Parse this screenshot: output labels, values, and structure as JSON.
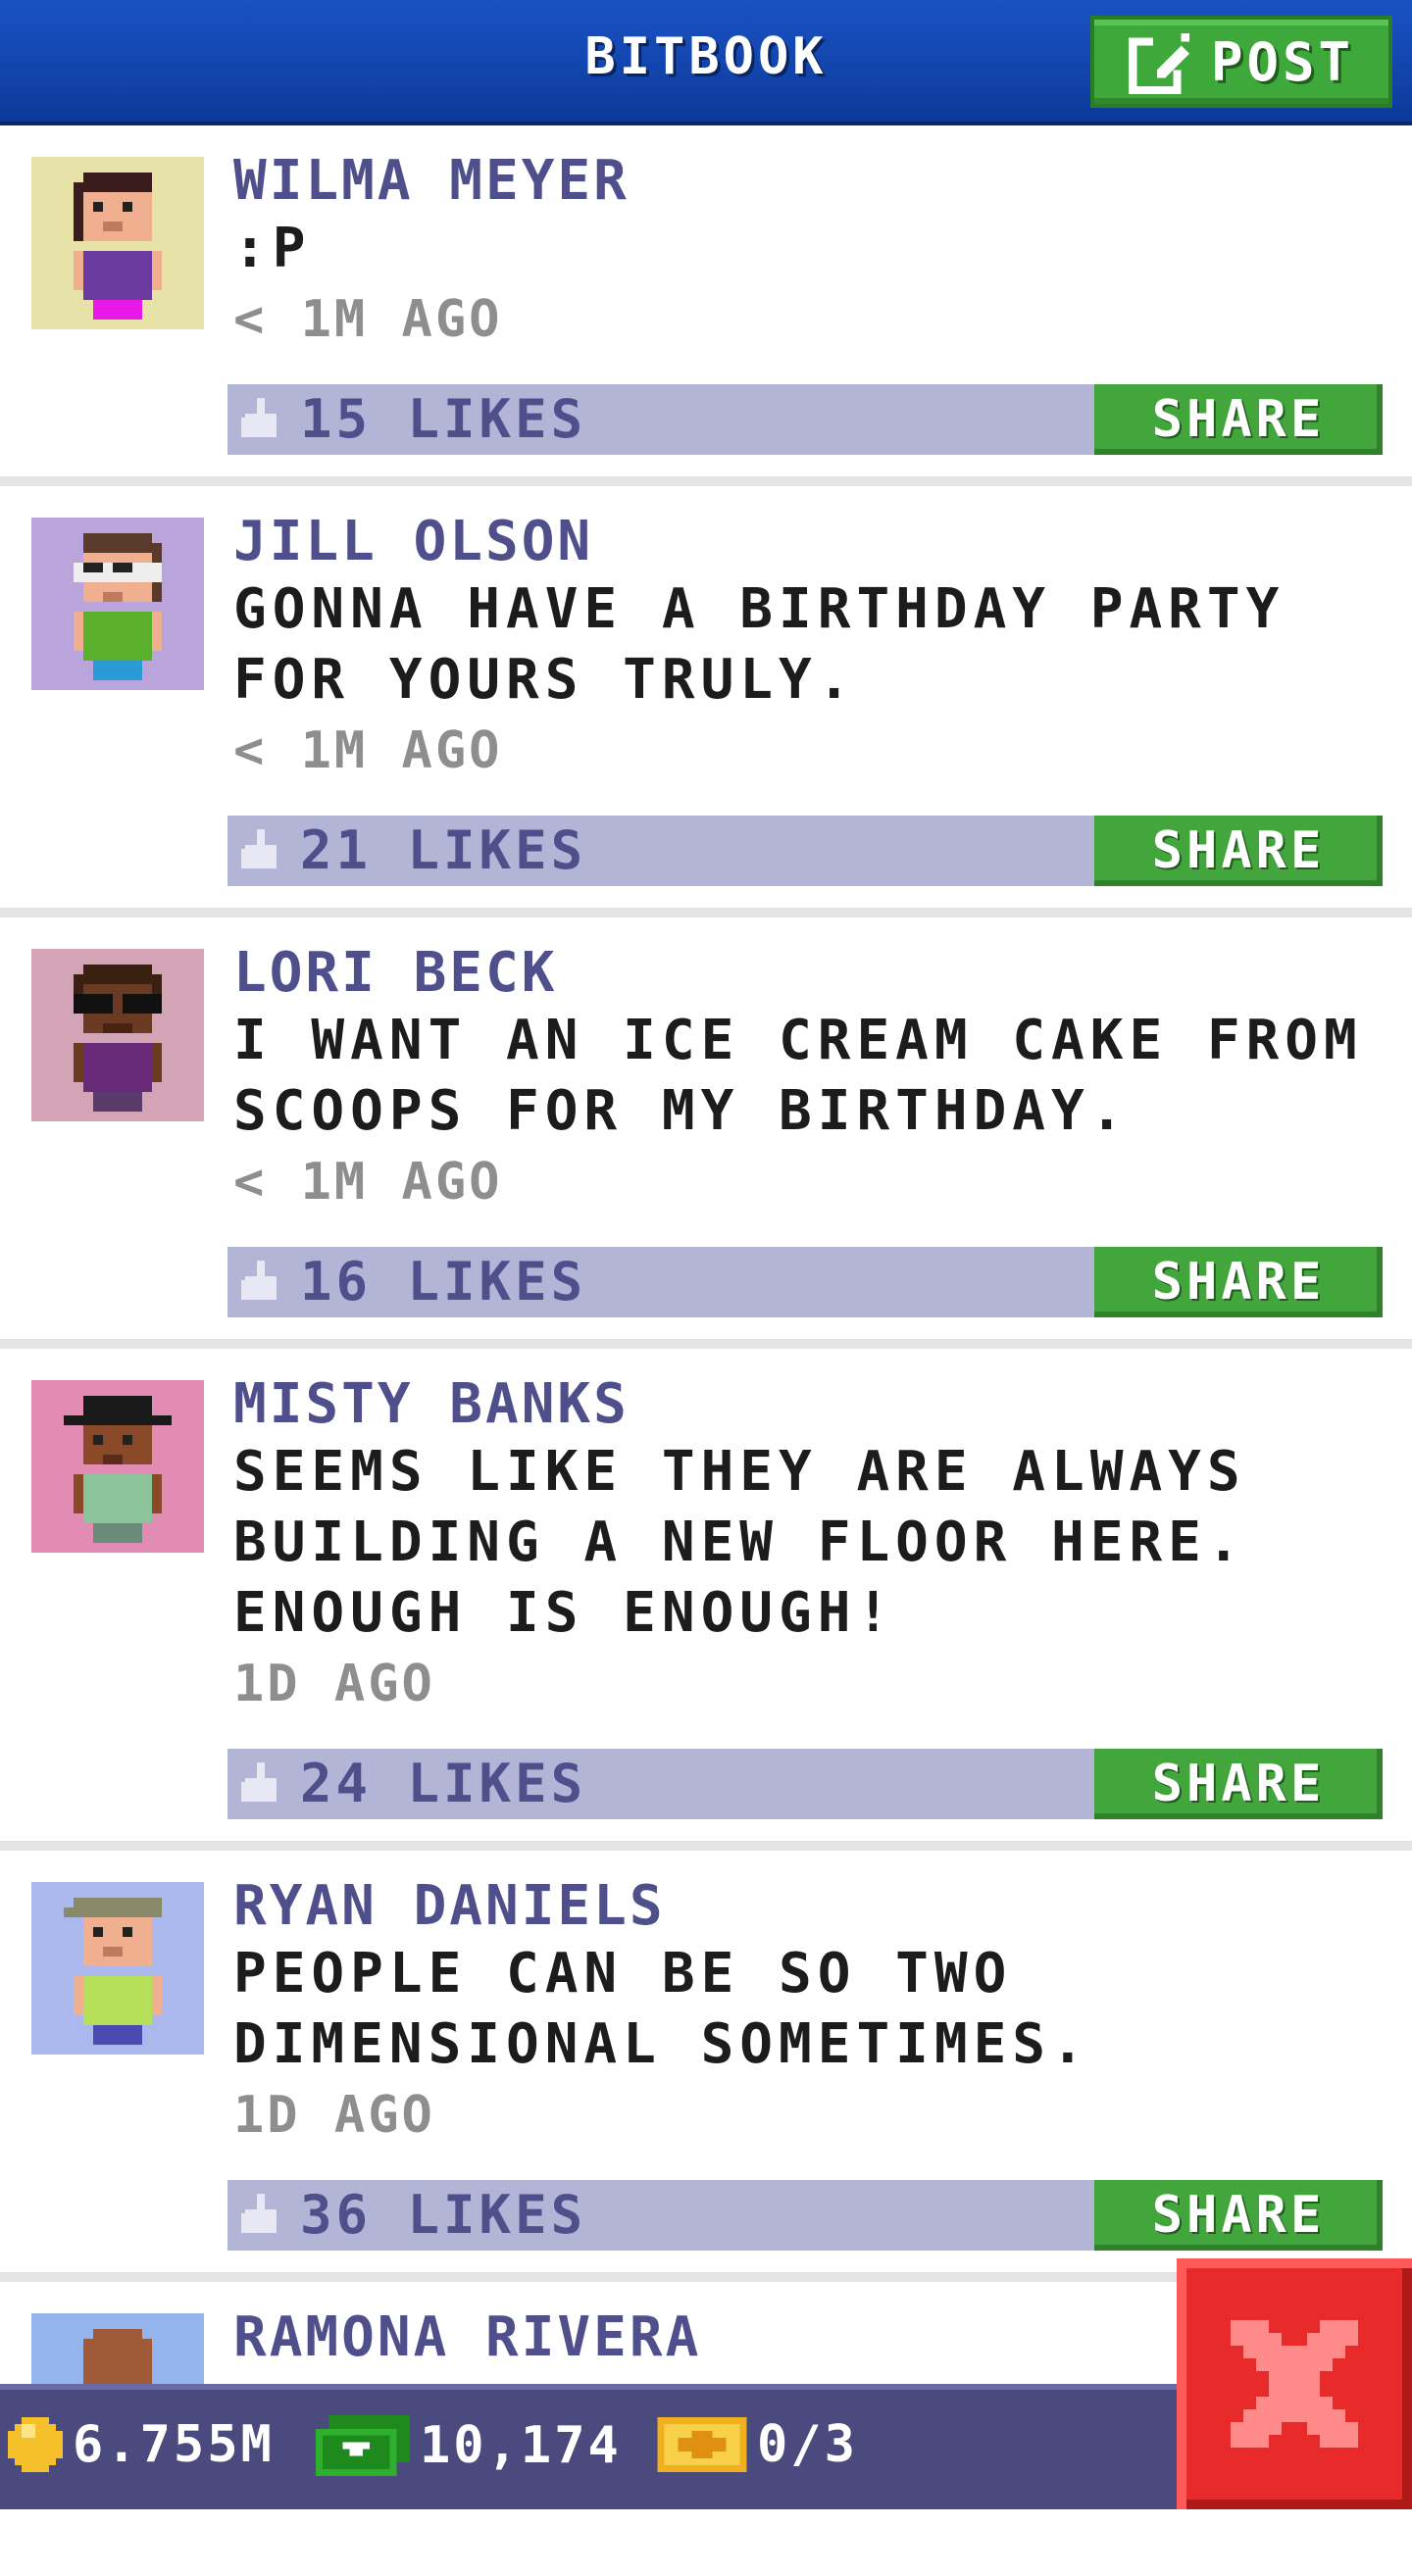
{
  "header": {
    "title": "BITBOOK",
    "post_label": "POST"
  },
  "posts": [
    {
      "name": "WILMA MEYER",
      "message": ":P",
      "time": "< 1M AGO",
      "likes": "15 LIKES",
      "share": "SHARE",
      "avatar_bg": "#e6e2a8",
      "skin": "#f0b090",
      "hair": "#3a1c1c",
      "shirt": "#6a3aa0",
      "legs": "#e818e8"
    },
    {
      "name": "JILL OLSON",
      "message": "GONNA HAVE A BIRTHDAY PARTY FOR YOURS TRULY.",
      "time": "< 1M AGO",
      "likes": "21 LIKES",
      "share": "SHARE",
      "avatar_bg": "#baa4dc",
      "skin": "#f0b090",
      "hair": "#5a3a2a",
      "shirt": "#5ab02a",
      "legs": "#2a9ad6"
    },
    {
      "name": "LORI BECK",
      "message": "I WANT AN ICE CREAM CAKE FROM SCOOPS FOR MY BIRTHDAY.",
      "time": "< 1M AGO",
      "likes": "16 LIKES",
      "share": "SHARE",
      "avatar_bg": "#d3a4b6",
      "skin": "#6a3a22",
      "hair": "#3a2010",
      "shirt": "#6a2a7a",
      "legs": "#5a3a6a"
    },
    {
      "name": "MISTY BANKS",
      "message": "SEEMS LIKE THEY ARE ALWAYS BUILDING A NEW FLOOR HERE. ENOUGH IS ENOUGH!",
      "time": "1D AGO",
      "likes": "24 LIKES",
      "share": "SHARE",
      "avatar_bg": "#e28cb4",
      "skin": "#8a4a2a",
      "hair": "#1a1a1a",
      "shirt": "#8cc49a",
      "legs": "#6a8a7a"
    },
    {
      "name": "RYAN DANIELS",
      "message": "PEOPLE CAN BE SO TWO DIMENSIONAL SOMETIMES.",
      "time": "1D AGO",
      "likes": "36 LIKES",
      "share": "SHARE",
      "avatar_bg": "#aab8ee",
      "skin": "#f0b090",
      "hair": "#8a8a6a",
      "shirt": "#b6e05a",
      "legs": "#4a4ab0"
    },
    {
      "name": "RAMONA RIVERA",
      "message": "",
      "time": "",
      "likes": "",
      "share": "",
      "avatar_bg": "#94b4ee",
      "skin": "#a05a38",
      "hair": "#a05a38",
      "shirt": "#a05a38",
      "legs": "#a05a38"
    }
  ],
  "status": {
    "coins": "6.755M",
    "bux": "10,174",
    "tickets": "0/3"
  },
  "colors": {
    "header_blue": "#1a52c4",
    "accent_green": "#3fa83a",
    "like_bar": "#b3b5d6",
    "name_purple": "#4f4f8c",
    "close_red": "#e82a2a"
  },
  "icons": {
    "post": "edit-icon",
    "like": "thumbs-up-icon",
    "close": "close-icon",
    "coin": "coin-icon",
    "bux": "bux-icon",
    "ticket": "ticket-icon"
  }
}
